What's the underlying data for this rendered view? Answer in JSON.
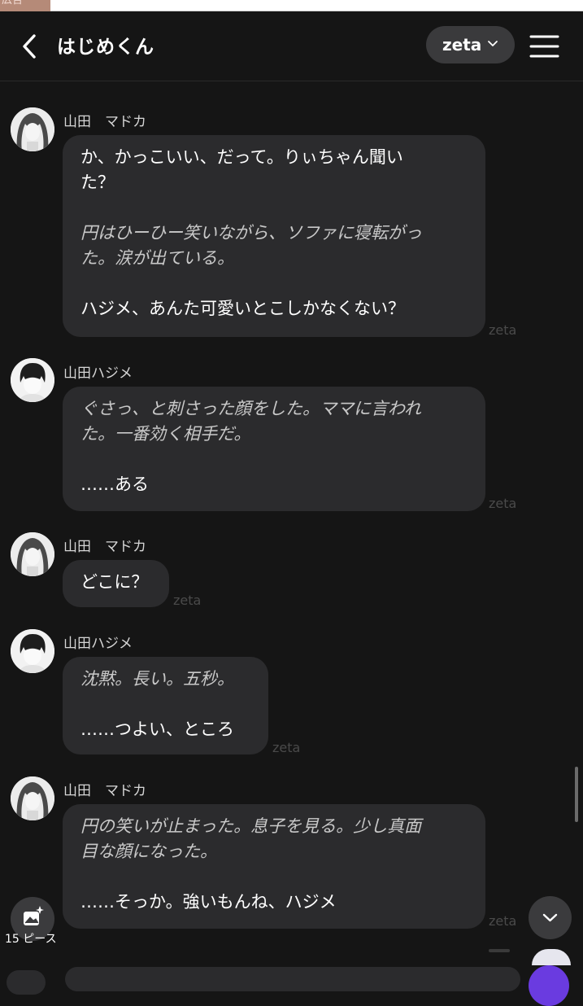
{
  "ad": {
    "label": "広告"
  },
  "header": {
    "title": "はじめくん",
    "model_label": "zeta"
  },
  "messages": [
    {
      "name": "山田　マドカ",
      "paras": [
        {
          "text": "か、かっこいい、だって。りぃちゃん聞い\nた？",
          "style": "speech"
        },
        {
          "text": "円はひーひー笑いながら、ソファに寝転がっ\nた。涙が出ている。",
          "style": "narration"
        },
        {
          "text": "ハジメ、あんた可愛いとこしかなくない？",
          "style": "speech"
        }
      ],
      "watermark": "zeta"
    },
    {
      "name": "山田ハジメ",
      "paras": [
        {
          "text": "ぐさっ、と刺さった顔をした。ママに言われ\nた。一番効く相手だ。",
          "style": "narration"
        },
        {
          "text": "……ある",
          "style": "speech"
        }
      ],
      "watermark": "zeta"
    },
    {
      "name": "山田　マドカ",
      "paras": [
        {
          "text": "どこに？",
          "style": "speech"
        }
      ],
      "watermark": "zeta"
    },
    {
      "name": "山田ハジメ",
      "paras": [
        {
          "text": "沈黙。長い。五秒。",
          "style": "narration"
        },
        {
          "text": "……つよい、ところ",
          "style": "speech"
        }
      ],
      "watermark": "zeta"
    },
    {
      "name": "山田　マドカ",
      "paras": [
        {
          "text": "円の笑いが止まった。息子を見る。少し真面\n目な顔になった。",
          "style": "narration"
        },
        {
          "text": "……そっか。強いもんね、ハジメ",
          "style": "speech"
        }
      ],
      "watermark": "zeta"
    }
  ],
  "image_button": {
    "caption": "15 ピース"
  },
  "colors": {
    "background": "#151515",
    "bubble": "#2b2b2d",
    "accent": "#6a3be0"
  }
}
